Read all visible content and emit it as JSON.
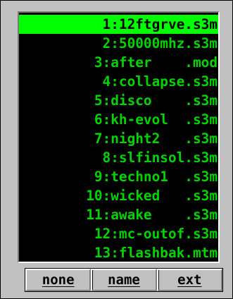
{
  "file_list": {
    "selected_index": 0,
    "items": [
      {
        "label": "1:12ftgrve.s3m"
      },
      {
        "label": "2:50000mhz.s3m"
      },
      {
        "label": "3:after    .mod"
      },
      {
        "label": "4:collapse.s3m"
      },
      {
        "label": "5:disco    .s3m"
      },
      {
        "label": "6:kh-evol  .s3m"
      },
      {
        "label": "7:night2   .s3m"
      },
      {
        "label": "8:slfinsol.s3m"
      },
      {
        "label": "9:techno1  .s3m"
      },
      {
        "label": "10:wicked   .s3m"
      },
      {
        "label": "11:awake    .s3m"
      },
      {
        "label": "12:mc-outof.s3m"
      },
      {
        "label": "13:flashbak.mtm"
      }
    ]
  },
  "sort_buttons": {
    "none_label": "none",
    "name_label": "name",
    "ext_label": "ext"
  },
  "colors": {
    "list_background": "#000000",
    "text_green": "#00d400",
    "selection_green": "#00ff00",
    "panel_gray": "#c0c0c0"
  }
}
